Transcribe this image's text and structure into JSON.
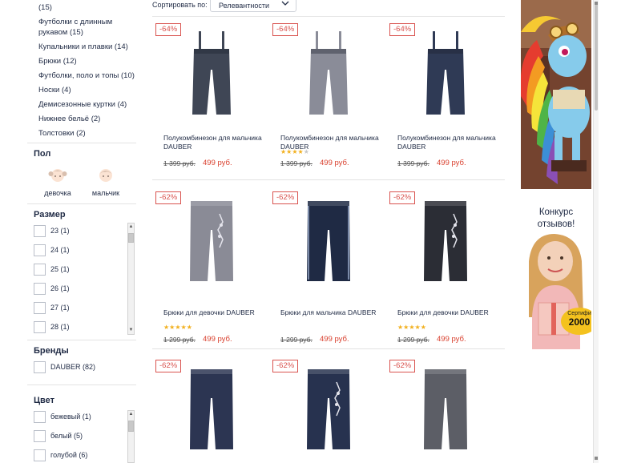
{
  "sidebar": {
    "categories": [
      "(15)",
      "Футболки с длинным рукавом (15)",
      "Купальники и плавки (14)",
      "Брюки (12)",
      "Футболки, поло и топы (10)",
      "Носки (4)",
      "Демисезонные куртки (4)",
      "Нижнее бельё (2)",
      "Толстовки (2)"
    ],
    "gender_title": "Пол",
    "gender": [
      {
        "label": "девочка",
        "icon": "girl-face-icon"
      },
      {
        "label": "мальчик",
        "icon": "boy-face-icon"
      }
    ],
    "size_title": "Размер",
    "sizes": [
      "23 (1)",
      "24 (1)",
      "25 (1)",
      "26 (1)",
      "27 (1)",
      "28 (1)"
    ],
    "brands_title": "Бренды",
    "brands": [
      "DAUBER (82)"
    ],
    "color_title": "Цвет",
    "colors": [
      "бежевый (1)",
      "белый (5)",
      "голубой (6)"
    ]
  },
  "sort": {
    "label": "Сортировать по:",
    "selected": "Релевантности",
    "icon": "chevron-down-icon"
  },
  "products": [
    {
      "discount": "-64%",
      "name": "Полукомбинезон для мальчика DAUBER",
      "rating": 0,
      "old_price": "1 399 руб.",
      "new_price": "499 руб.",
      "garment": "overalls",
      "color": "#3f4655"
    },
    {
      "discount": "-64%",
      "name": "Полукомбинезон для мальчика DAUBER",
      "rating": 4,
      "old_price": "1 399 руб.",
      "new_price": "499 руб.",
      "garment": "overalls",
      "color": "#8a8c98"
    },
    {
      "discount": "-64%",
      "name": "Полукомбинезон для мальчика DAUBER",
      "rating": 0,
      "old_price": "1 399 руб.",
      "new_price": "499 руб.",
      "garment": "overalls",
      "color": "#2f3a55"
    },
    {
      "discount": "-62%",
      "name": "Брюки для девочки DAUBER",
      "rating": 5,
      "old_price": "1 299 руб.",
      "new_price": "499 руб.",
      "garment": "pants-print",
      "color": "#8a8b96"
    },
    {
      "discount": "-62%",
      "name": "Брюки для мальчика DAUBER",
      "rating": 0,
      "old_price": "1 299 руб.",
      "new_price": "499 руб.",
      "garment": "pants-stripe",
      "color": "#1f2a44"
    },
    {
      "discount": "-62%",
      "name": "Брюки для девочки DAUBER",
      "rating": 5,
      "old_price": "1 299 руб.",
      "new_price": "499 руб.",
      "garment": "pants-print",
      "color": "#2b2d35"
    },
    {
      "discount": "-62%",
      "name": "",
      "rating": 0,
      "old_price": "",
      "new_price": "",
      "garment": "pants",
      "color": "#2c3552"
    },
    {
      "discount": "-62%",
      "name": "",
      "rating": 0,
      "old_price": "",
      "new_price": "",
      "garment": "pants-print",
      "color": "#27324f"
    },
    {
      "discount": "-62%",
      "name": "",
      "rating": 0,
      "old_price": "",
      "new_price": "",
      "garment": "pants",
      "color": "#5c5e66"
    }
  ],
  "banner": {
    "contest_line1": "Конкурс",
    "contest_line2": "отзывов!",
    "cert_line1": "Сертифи",
    "cert_line2": "2000"
  },
  "colors": {
    "discount_red": "#d9534f",
    "price_red": "#d9402e",
    "star_gold": "#f2b01e",
    "text_navy": "#1f2a44"
  }
}
